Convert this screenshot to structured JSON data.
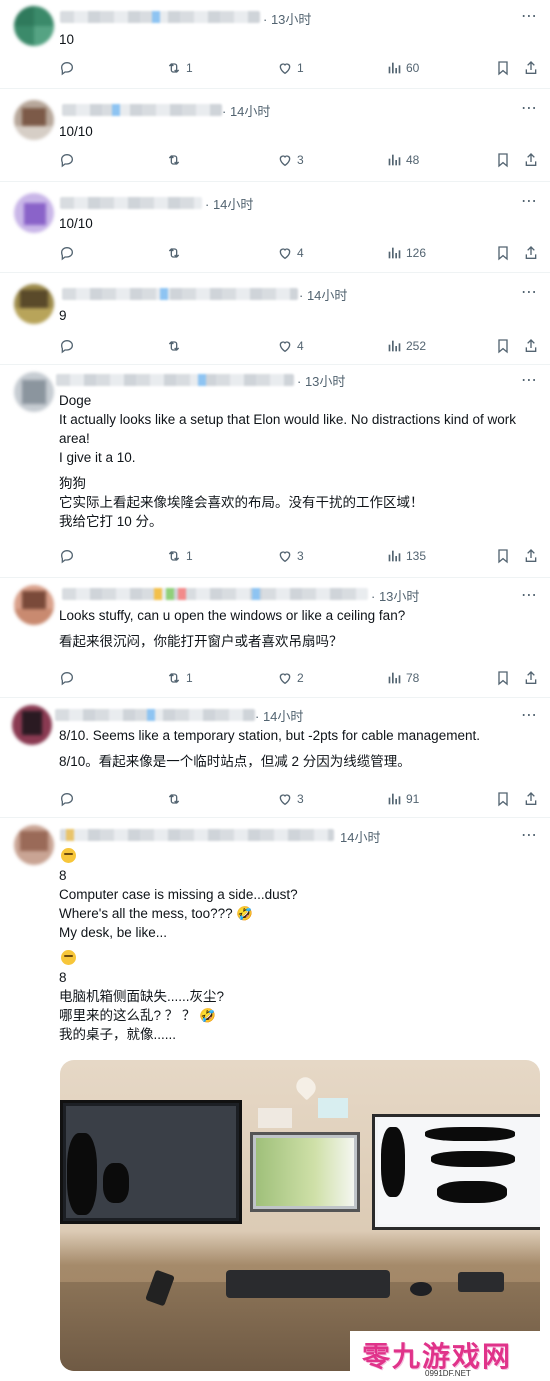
{
  "replies": [
    {
      "time": "· 13小时",
      "lines": [
        "10"
      ],
      "replies_count": "",
      "retweets": "1",
      "likes": "1",
      "views": "60"
    },
    {
      "time": "· 14小时",
      "lines": [
        "10/10"
      ],
      "replies_count": "",
      "retweets": "",
      "likes": "3",
      "views": "48"
    },
    {
      "time": "· 14小时",
      "lines": [
        "10/10"
      ],
      "replies_count": "",
      "retweets": "",
      "likes": "4",
      "views": "126"
    },
    {
      "time": "· 14小时",
      "lines": [
        "9"
      ],
      "replies_count": "",
      "retweets": "",
      "likes": "4",
      "views": "252"
    },
    {
      "time": "· 13小时",
      "lines": [
        "Doge",
        "It actually looks like a setup that Elon would like. No distractions kind of work area!",
        "I give it a 10.",
        "",
        "狗狗",
        "它实际上看起来像埃隆会喜欢的布局。没有干扰的工作区域！",
        "我给它打 10 分。"
      ],
      "replies_count": "",
      "retweets": "1",
      "likes": "3",
      "views": "135"
    },
    {
      "time": "· 13小时",
      "lines": [
        "Looks stuffy, can u open the windows or like a ceiling fan?",
        "",
        "看起来很沉闷，你能打开窗户或者喜欢吊扇吗？"
      ],
      "replies_count": "",
      "retweets": "1",
      "likes": "2",
      "views": "78"
    },
    {
      "time": "· 14小时",
      "lines": [
        "8/10. Seems like a temporary station, but -2pts for cable management.",
        "",
        "8/10。看起来像是一个临时站点，但减 2 分因为线缆管理。"
      ],
      "replies_count": "",
      "retweets": "",
      "likes": "3",
      "views": "91"
    },
    {
      "time": "14小时",
      "lines": [
        "🤔",
        "8",
        "Computer case is missing a side...dust?",
        "Where's all the mess, too??? 🤣",
        "My desk, be like...",
        "",
        "🤔",
        "8",
        "电脑机箱侧面缺失......灰尘?",
        "哪里来的这么乱? ？ ？ 🤣",
        "我的桌子，就像......"
      ],
      "replies_count": "",
      "retweets": "",
      "likes": "",
      "views": ""
    }
  ],
  "watermark": {
    "title": "零九游戏网",
    "url": "0991DF.NET"
  },
  "icons": {
    "more": "more-dots-icon",
    "reply": "reply-icon",
    "retweet": "retweet-icon",
    "like": "heart-icon",
    "views": "views-icon",
    "bookmark": "bookmark-icon",
    "share": "share-icon"
  },
  "colors": {
    "text": "#0f1419",
    "muted": "#536471",
    "divider": "#eff3f4",
    "watermark": "#e0338a"
  }
}
